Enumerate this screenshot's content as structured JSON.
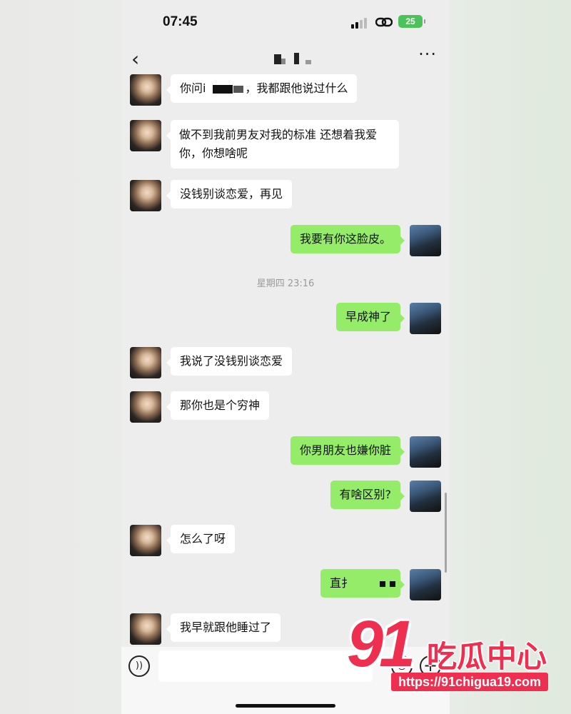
{
  "status_bar": {
    "time": "07:45",
    "battery_level": "25"
  },
  "header": {
    "back_icon": "chevron-left-icon",
    "more_label": "···"
  },
  "messages": [
    {
      "side": "in",
      "text_before": "你问i",
      "text_after": "，我都跟他说过什么"
    },
    {
      "side": "in",
      "text": "做不到我前男友对我的标准 还想着我爱你，你想啥呢"
    },
    {
      "side": "in",
      "text": "没钱别谈恋爱，再见"
    },
    {
      "side": "out",
      "text": "我要有你这脸皮。"
    },
    {
      "side": "out",
      "text": "早成神了"
    },
    {
      "side": "in",
      "text": "我说了没钱别谈恋爱"
    },
    {
      "side": "in",
      "text": "那你也是个穷神"
    },
    {
      "side": "out",
      "text": "你男朋友也嫌你脏"
    },
    {
      "side": "out",
      "text": "有啥区别?"
    },
    {
      "side": "in",
      "text": "怎么了呀"
    },
    {
      "side": "out",
      "text_before": "直扌"
    },
    {
      "side": "in",
      "text": "我早就跟他睡过了"
    }
  ],
  "timestamp": "星期四 23:16",
  "input_bar": {
    "voice_icon": "voice-icon",
    "emoji_icon": "emoji-icon",
    "plus_icon": "plus-icon"
  },
  "watermark": {
    "number": "91",
    "name": "吃瓜中心",
    "url": "https://91chigua19.com"
  },
  "colors": {
    "outgoing_bubble": "#95ec69",
    "incoming_bubble": "#ffffff",
    "chat_background": "#ededed",
    "watermark": "#ef2f4f"
  }
}
